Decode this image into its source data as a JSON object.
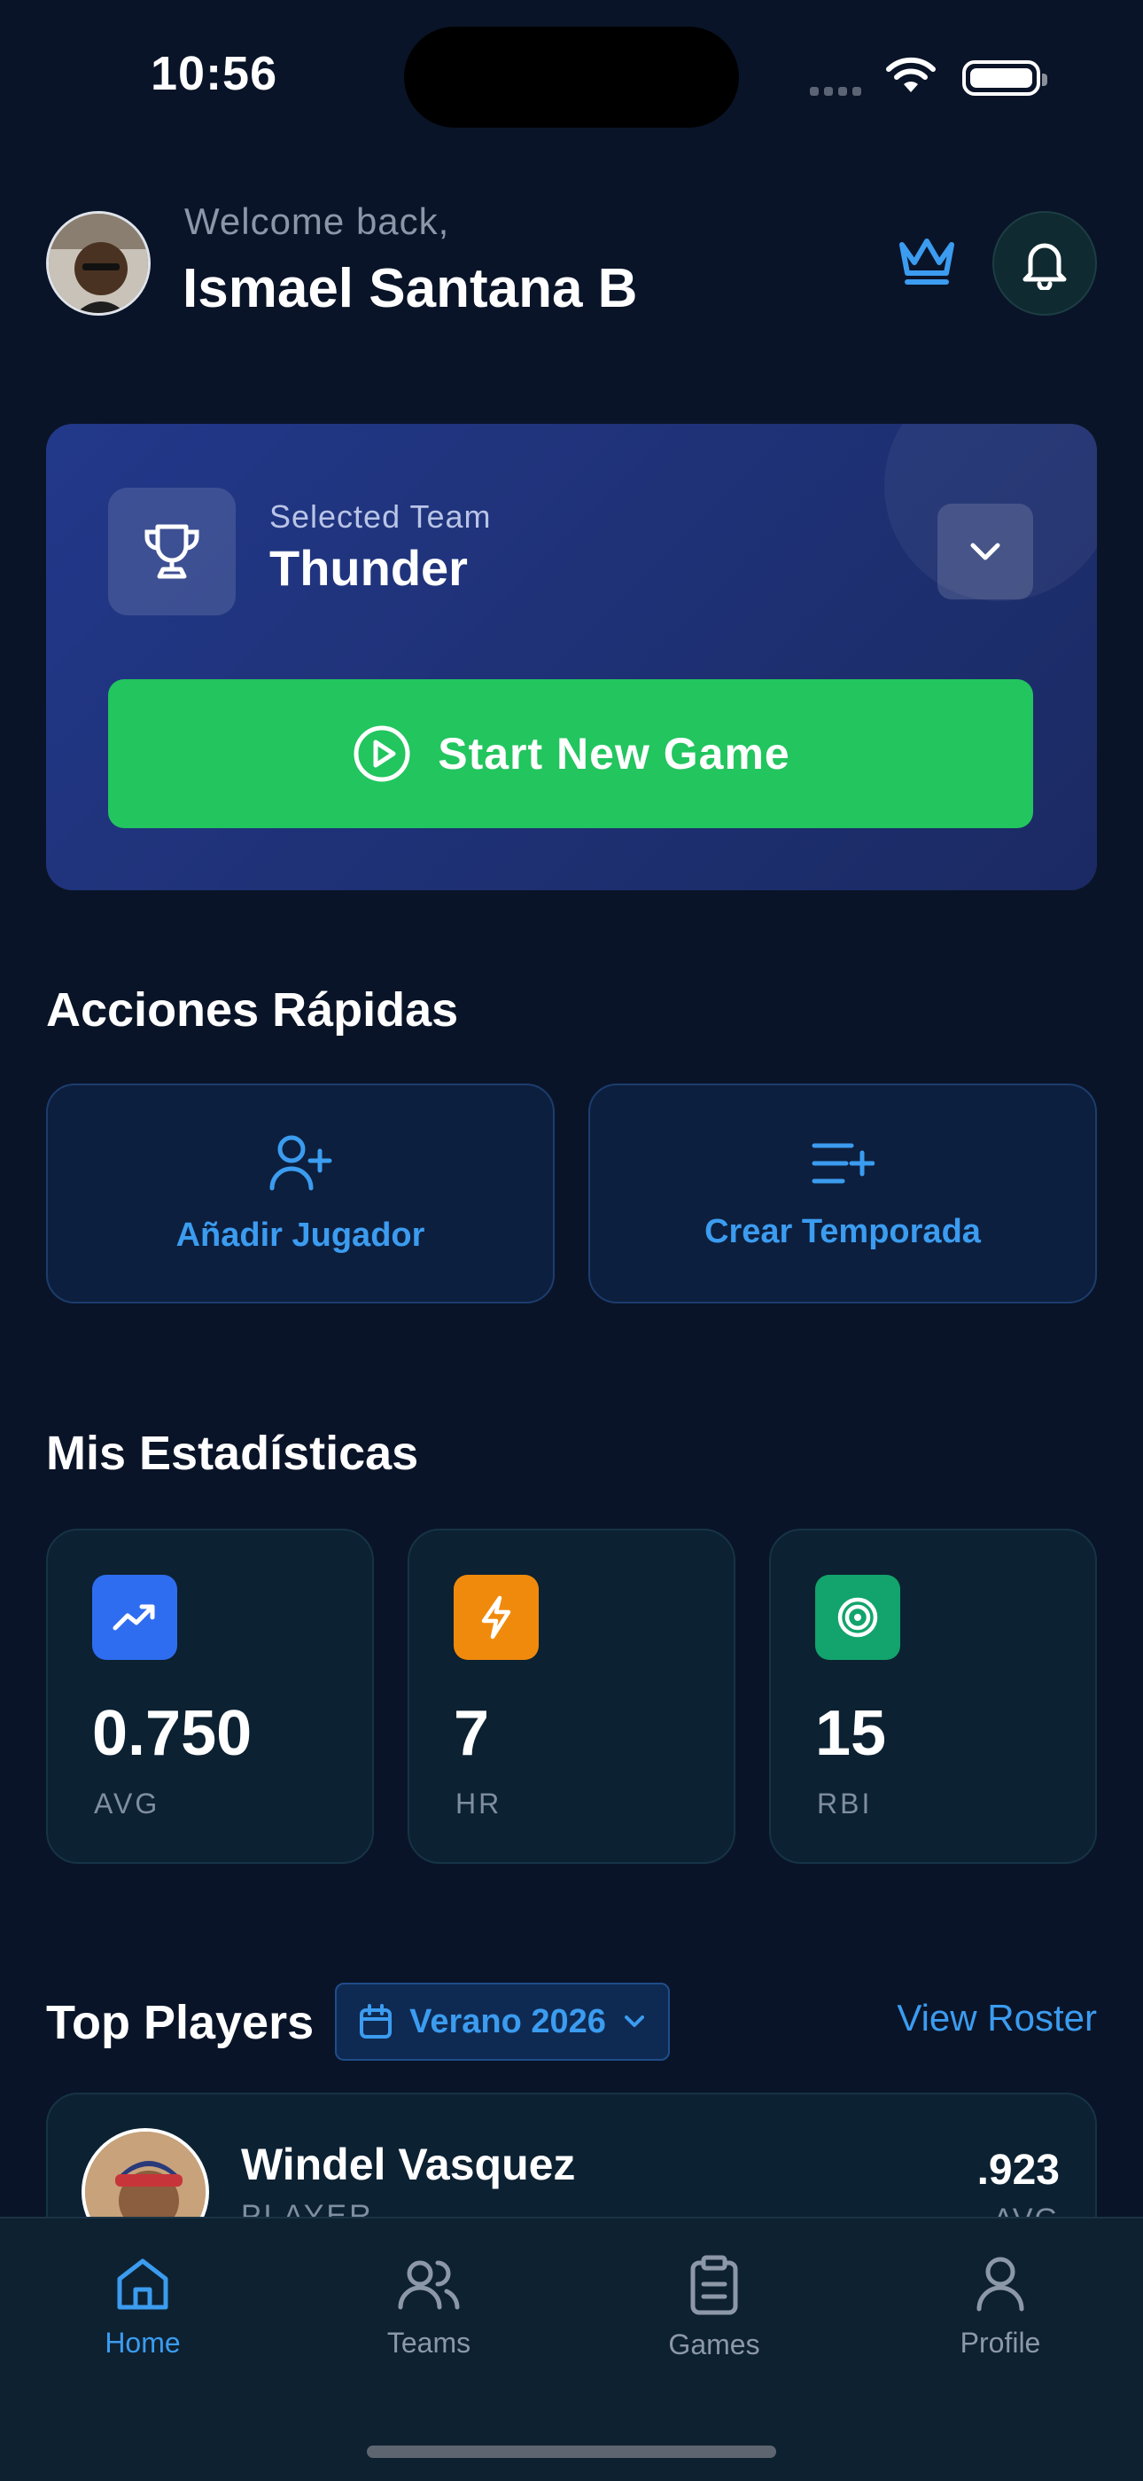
{
  "status_bar": {
    "time": "10:56"
  },
  "header": {
    "welcome": "Welcome back,",
    "username": "Ismael Santana B",
    "crown_icon": "crown-icon",
    "bell_icon": "bell-icon"
  },
  "team_card": {
    "label": "Selected Team",
    "team_name": "Thunder",
    "start_button": "Start New Game"
  },
  "quick_actions": {
    "title": "Acciones Rápidas",
    "items": [
      {
        "label": "Añadir Jugador",
        "icon": "user-plus-icon"
      },
      {
        "label": "Crear Temporada",
        "icon": "list-plus-icon"
      }
    ]
  },
  "stats": {
    "title": "Mis Estadísticas",
    "items": [
      {
        "value": "0.750",
        "label": "AVG",
        "icon": "trending-up-icon",
        "color": "#2f6df0"
      },
      {
        "value": "7",
        "label": "HR",
        "icon": "zap-icon",
        "color": "#f08a0c"
      },
      {
        "value": "15",
        "label": "RBI",
        "icon": "target-icon",
        "color": "#12a46c"
      }
    ]
  },
  "top_players": {
    "title": "Top Players",
    "season": "Verano 2026",
    "view_roster": "View Roster",
    "players": [
      {
        "name": "Windel Vasquez",
        "role": "PLAYER",
        "avg": ".923",
        "avg_label": "AVG"
      }
    ]
  },
  "tabbar": {
    "items": [
      {
        "label": "Home",
        "active": true
      },
      {
        "label": "Teams",
        "active": false
      },
      {
        "label": "Games",
        "active": false
      },
      {
        "label": "Profile",
        "active": false
      }
    ]
  },
  "colors": {
    "accent": "#3b9cf0",
    "green": "#22c55e",
    "background": "#0a1428"
  }
}
